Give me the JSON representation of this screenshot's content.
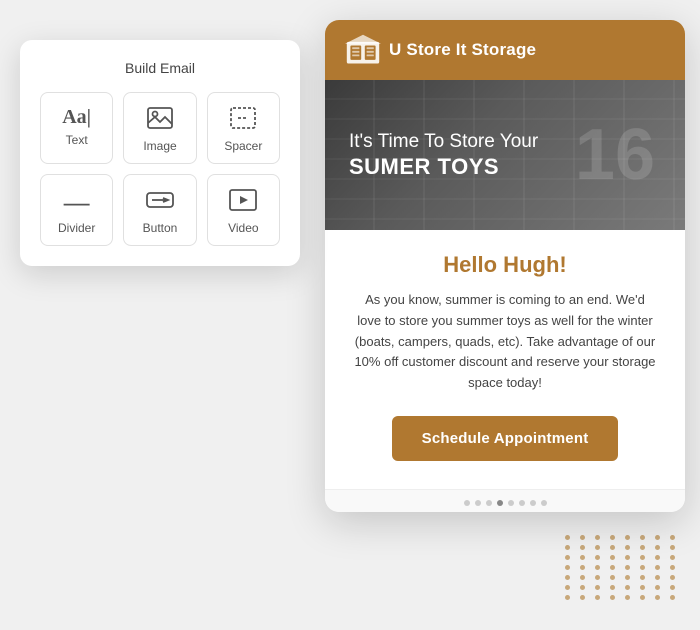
{
  "build_email": {
    "title": "Build Email",
    "blocks": [
      {
        "id": "text",
        "label": "Text",
        "icon": "Aa|"
      },
      {
        "id": "image",
        "label": "Image",
        "icon": "🖼"
      },
      {
        "id": "spacer",
        "label": "Spacer",
        "icon": "⬚"
      },
      {
        "id": "divider",
        "label": "Divider",
        "icon": "—"
      },
      {
        "id": "button",
        "label": "Button",
        "icon": "⬚→"
      },
      {
        "id": "video",
        "label": "Video",
        "icon": "▶"
      }
    ]
  },
  "email_preview": {
    "header": {
      "logo_text": "U Store It Storage"
    },
    "hero": {
      "line1": "It's Time To Store Your",
      "line2": "SUMER TOYS",
      "bg_number": "16"
    },
    "body": {
      "greeting": "Hello Hugh!",
      "body_text": "As you know, summer is coming to an end. We'd love to store you summer toys as well for the winter (boats, campers, quads, etc). Take advantage of our 10% off customer discount and reserve your storage space today!",
      "cta_label": "Schedule Appointment"
    },
    "colors": {
      "brand": "#b07830",
      "white": "#ffffff",
      "text": "#444444"
    }
  }
}
